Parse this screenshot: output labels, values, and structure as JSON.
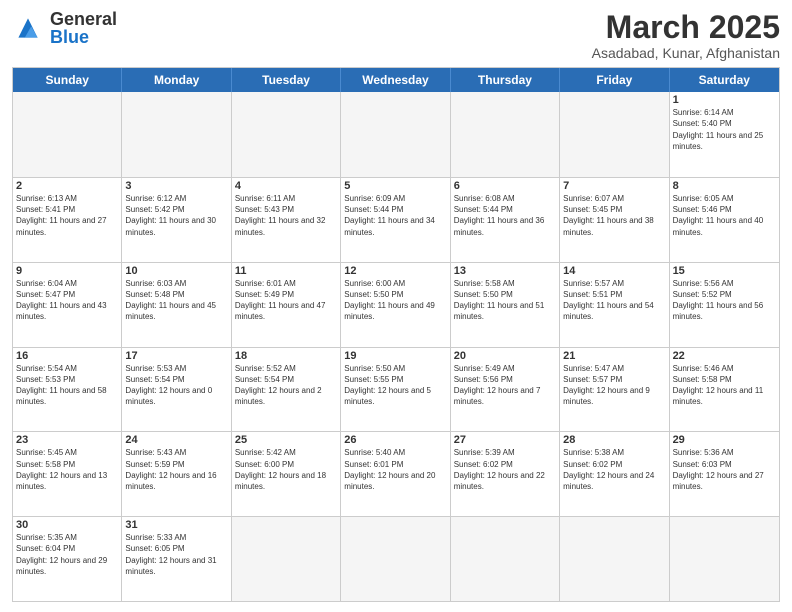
{
  "logo": {
    "general": "General",
    "blue": "Blue"
  },
  "title": {
    "month_year": "March 2025",
    "location": "Asadabad, Kunar, Afghanistan"
  },
  "header_days": [
    "Sunday",
    "Monday",
    "Tuesday",
    "Wednesday",
    "Thursday",
    "Friday",
    "Saturday"
  ],
  "weeks": [
    [
      {
        "day": "",
        "info": ""
      },
      {
        "day": "",
        "info": ""
      },
      {
        "day": "",
        "info": ""
      },
      {
        "day": "",
        "info": ""
      },
      {
        "day": "",
        "info": ""
      },
      {
        "day": "",
        "info": ""
      },
      {
        "day": "1",
        "info": "Sunrise: 6:14 AM\nSunset: 5:40 PM\nDaylight: 11 hours and 25 minutes."
      }
    ],
    [
      {
        "day": "2",
        "info": "Sunrise: 6:13 AM\nSunset: 5:41 PM\nDaylight: 11 hours and 27 minutes."
      },
      {
        "day": "3",
        "info": "Sunrise: 6:12 AM\nSunset: 5:42 PM\nDaylight: 11 hours and 30 minutes."
      },
      {
        "day": "4",
        "info": "Sunrise: 6:11 AM\nSunset: 5:43 PM\nDaylight: 11 hours and 32 minutes."
      },
      {
        "day": "5",
        "info": "Sunrise: 6:09 AM\nSunset: 5:44 PM\nDaylight: 11 hours and 34 minutes."
      },
      {
        "day": "6",
        "info": "Sunrise: 6:08 AM\nSunset: 5:44 PM\nDaylight: 11 hours and 36 minutes."
      },
      {
        "day": "7",
        "info": "Sunrise: 6:07 AM\nSunset: 5:45 PM\nDaylight: 11 hours and 38 minutes."
      },
      {
        "day": "8",
        "info": "Sunrise: 6:05 AM\nSunset: 5:46 PM\nDaylight: 11 hours and 40 minutes."
      }
    ],
    [
      {
        "day": "9",
        "info": "Sunrise: 6:04 AM\nSunset: 5:47 PM\nDaylight: 11 hours and 43 minutes."
      },
      {
        "day": "10",
        "info": "Sunrise: 6:03 AM\nSunset: 5:48 PM\nDaylight: 11 hours and 45 minutes."
      },
      {
        "day": "11",
        "info": "Sunrise: 6:01 AM\nSunset: 5:49 PM\nDaylight: 11 hours and 47 minutes."
      },
      {
        "day": "12",
        "info": "Sunrise: 6:00 AM\nSunset: 5:50 PM\nDaylight: 11 hours and 49 minutes."
      },
      {
        "day": "13",
        "info": "Sunrise: 5:58 AM\nSunset: 5:50 PM\nDaylight: 11 hours and 51 minutes."
      },
      {
        "day": "14",
        "info": "Sunrise: 5:57 AM\nSunset: 5:51 PM\nDaylight: 11 hours and 54 minutes."
      },
      {
        "day": "15",
        "info": "Sunrise: 5:56 AM\nSunset: 5:52 PM\nDaylight: 11 hours and 56 minutes."
      }
    ],
    [
      {
        "day": "16",
        "info": "Sunrise: 5:54 AM\nSunset: 5:53 PM\nDaylight: 11 hours and 58 minutes."
      },
      {
        "day": "17",
        "info": "Sunrise: 5:53 AM\nSunset: 5:54 PM\nDaylight: 12 hours and 0 minutes."
      },
      {
        "day": "18",
        "info": "Sunrise: 5:52 AM\nSunset: 5:54 PM\nDaylight: 12 hours and 2 minutes."
      },
      {
        "day": "19",
        "info": "Sunrise: 5:50 AM\nSunset: 5:55 PM\nDaylight: 12 hours and 5 minutes."
      },
      {
        "day": "20",
        "info": "Sunrise: 5:49 AM\nSunset: 5:56 PM\nDaylight: 12 hours and 7 minutes."
      },
      {
        "day": "21",
        "info": "Sunrise: 5:47 AM\nSunset: 5:57 PM\nDaylight: 12 hours and 9 minutes."
      },
      {
        "day": "22",
        "info": "Sunrise: 5:46 AM\nSunset: 5:58 PM\nDaylight: 12 hours and 11 minutes."
      }
    ],
    [
      {
        "day": "23",
        "info": "Sunrise: 5:45 AM\nSunset: 5:58 PM\nDaylight: 12 hours and 13 minutes."
      },
      {
        "day": "24",
        "info": "Sunrise: 5:43 AM\nSunset: 5:59 PM\nDaylight: 12 hours and 16 minutes."
      },
      {
        "day": "25",
        "info": "Sunrise: 5:42 AM\nSunset: 6:00 PM\nDaylight: 12 hours and 18 minutes."
      },
      {
        "day": "26",
        "info": "Sunrise: 5:40 AM\nSunset: 6:01 PM\nDaylight: 12 hours and 20 minutes."
      },
      {
        "day": "27",
        "info": "Sunrise: 5:39 AM\nSunset: 6:02 PM\nDaylight: 12 hours and 22 minutes."
      },
      {
        "day": "28",
        "info": "Sunrise: 5:38 AM\nSunset: 6:02 PM\nDaylight: 12 hours and 24 minutes."
      },
      {
        "day": "29",
        "info": "Sunrise: 5:36 AM\nSunset: 6:03 PM\nDaylight: 12 hours and 27 minutes."
      }
    ],
    [
      {
        "day": "30",
        "info": "Sunrise: 5:35 AM\nSunset: 6:04 PM\nDaylight: 12 hours and 29 minutes."
      },
      {
        "day": "31",
        "info": "Sunrise: 5:33 AM\nSunset: 6:05 PM\nDaylight: 12 hours and 31 minutes."
      },
      {
        "day": "",
        "info": ""
      },
      {
        "day": "",
        "info": ""
      },
      {
        "day": "",
        "info": ""
      },
      {
        "day": "",
        "info": ""
      },
      {
        "day": "",
        "info": ""
      }
    ]
  ]
}
